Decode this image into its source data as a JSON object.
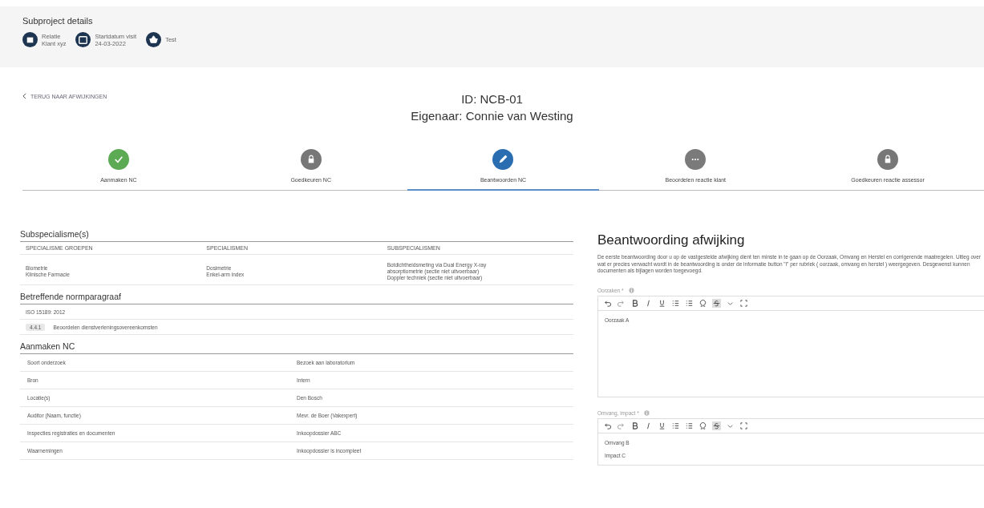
{
  "subproject": {
    "title": "Subproject details",
    "items": [
      {
        "lines": [
          "Relatie",
          "Klant xyz"
        ]
      },
      {
        "lines": [
          "Startdatum visit",
          "24-03-2022"
        ]
      },
      {
        "lines": [
          "Test"
        ]
      }
    ]
  },
  "back_link": "TERUG NAAR AFWIJKINGEN",
  "header": {
    "id": "ID: NCB-01",
    "owner": "Eigenaar: Connie van Westing"
  },
  "steps": [
    {
      "label": "Aanmaken NC",
      "kind": "done",
      "selected": false
    },
    {
      "label": "Goedkeuren NC",
      "kind": "locked",
      "selected": false
    },
    {
      "label": "Beantwoorden NC",
      "kind": "active",
      "selected": true
    },
    {
      "label": "Beoordelen reactie klant",
      "kind": "pending",
      "selected": false
    },
    {
      "label": "Goedkeuren reactie assessor",
      "kind": "locked",
      "selected": false
    }
  ],
  "subspecialismen": {
    "title": "Subspecialisme(s)",
    "columns": [
      "SPECIALISME GROEPEN",
      "SPECIALISMEN",
      "SUBSPECIALISMEN"
    ],
    "rows": [
      [
        [
          "Biometrie",
          "Klinische Farmacie"
        ],
        [
          "Dosimetrie",
          "Enkel-arm index"
        ],
        [
          "Botdichtheidsmeting via Dual Energy X-ray",
          "absorptiometrie (sectie niet uitvoerbaar)",
          "Doppler techniek (sectie niet uitvoerbaar)"
        ]
      ]
    ]
  },
  "normparagraaf": {
    "title": "Betreffende normparagraaf",
    "norm": "ISO 15189: 2012",
    "paragraphs": [
      {
        "code": "4.4.1",
        "text": "Beoordelen dienstverleningsovereenkomsten"
      }
    ]
  },
  "aanmaken": {
    "title": "Aanmaken NC",
    "rows": [
      {
        "label": "Soort onderzoek",
        "value": "Bezoek aan laboratorium"
      },
      {
        "label": "Bron",
        "value": "Intern"
      },
      {
        "label": "Locatie(s)",
        "value": "Den Bosch"
      },
      {
        "label": "Auditor (Naam, functie)",
        "value": "Mevr. de Boer (Vakexpert)"
      },
      {
        "label": "Inspecties registraties en documenten",
        "value": "Inkoopdossier ABC"
      },
      {
        "label": "Waarnemingen",
        "value": "Inkoopdossier is incompleet"
      }
    ]
  },
  "beantwoording": {
    "title": "Beantwoording afwijking",
    "intro": "De eerste beantwoording door u op de vastgestelde afwijking dient ten minste in te gaan op de Oorzaak, Omvang en Herstel en corrigerende maatregelen. Uitleg over wat er precies verwacht wordt in de beantwoording is onder de informatie button \"i\" per rubriek ( oorzaak, omvang en herstel ) weergegeven. Desgewenst kunnen documenten als bijlagen worden toegevoegd.",
    "editors": [
      {
        "label": "Oorzaken *",
        "lines": [
          "Oorzaak A"
        ]
      },
      {
        "label": "Omvang, impact *",
        "lines": [
          "Omvang B",
          "Impact C"
        ]
      }
    ]
  }
}
